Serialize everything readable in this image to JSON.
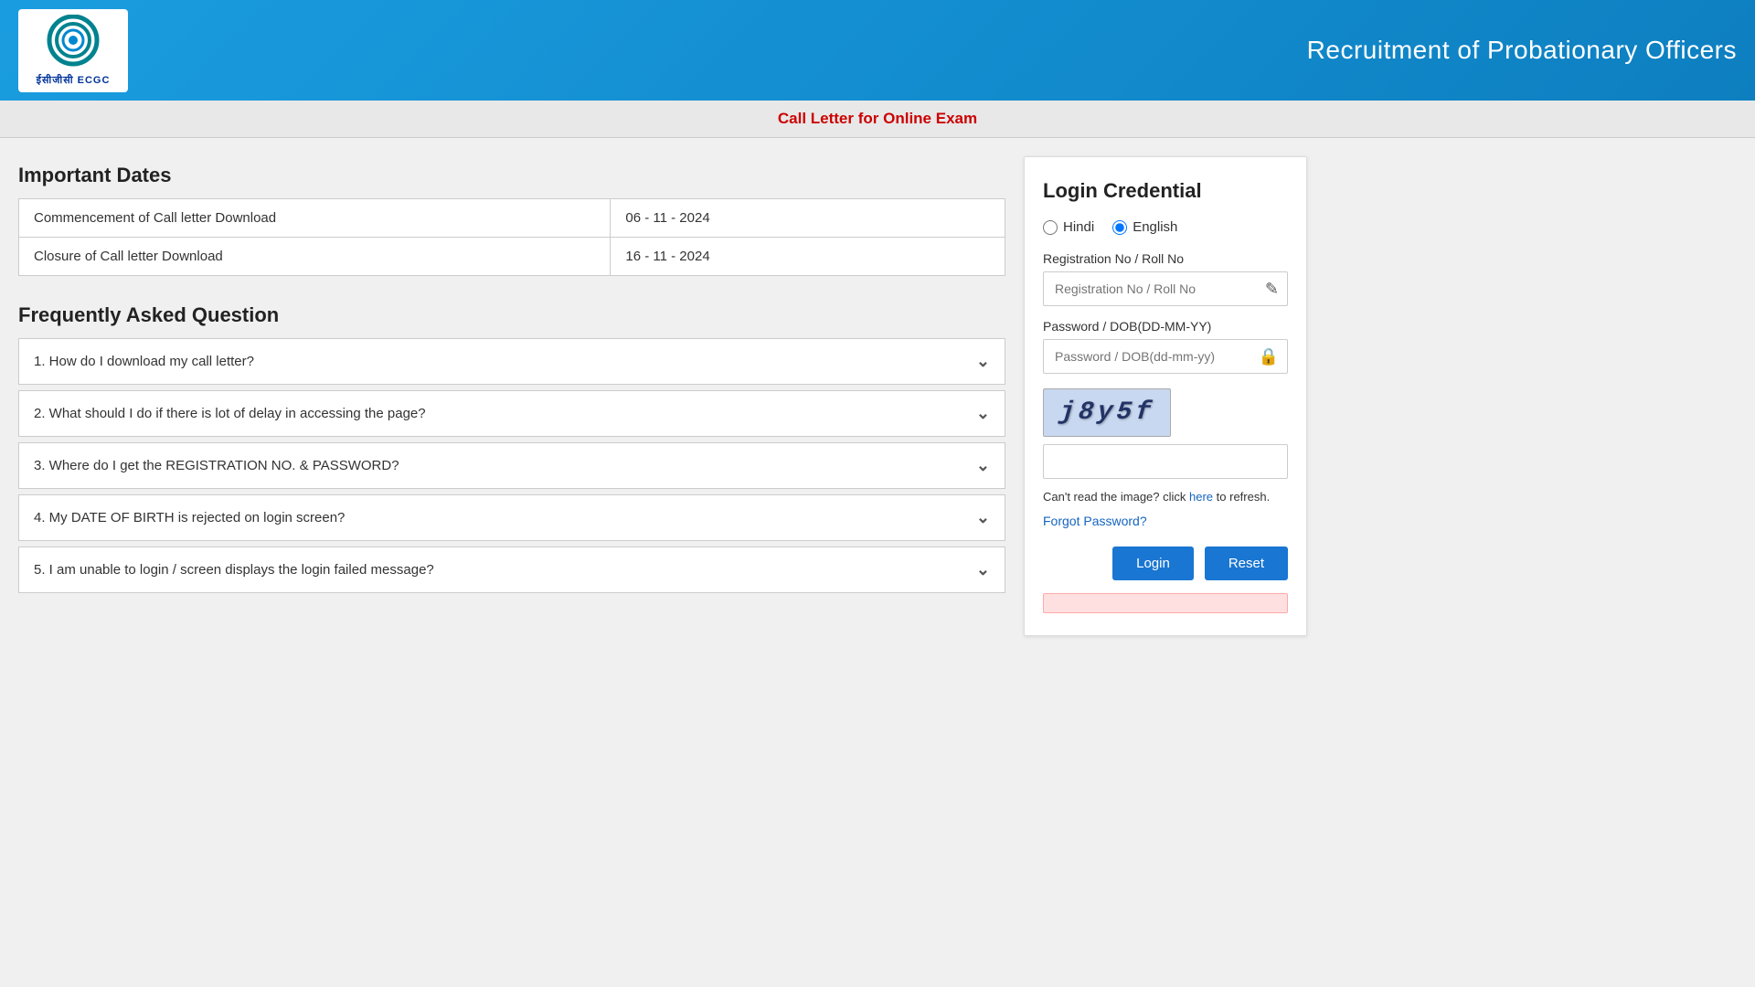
{
  "header": {
    "logo_text": "ईसीजीसी ECGC",
    "title": "Recruitment of Probationary Officers"
  },
  "sub_header": {
    "label": "Call Letter for Online Exam"
  },
  "important_dates": {
    "section_title": "Important Dates",
    "rows": [
      {
        "label": "Commencement of Call letter Download",
        "date": "06 - 11 - 2024"
      },
      {
        "label": "Closure of Call letter Download",
        "date": "16 - 11 - 2024"
      }
    ]
  },
  "faq": {
    "section_title": "Frequently Asked Question",
    "items": [
      {
        "id": 1,
        "question": "1. How do I download my call letter?"
      },
      {
        "id": 2,
        "question": "2. What should I do if there is lot of delay in accessing the page?"
      },
      {
        "id": 3,
        "question": "3. Where do I get the REGISTRATION NO. & PASSWORD?"
      },
      {
        "id": 4,
        "question": "4. My DATE OF BIRTH is rejected on login screen?"
      },
      {
        "id": 5,
        "question": "5. I am unable to login / screen displays the login failed message?"
      }
    ]
  },
  "login": {
    "title": "Login Credential",
    "language": {
      "hindi_label": "Hindi",
      "english_label": "English",
      "selected": "english"
    },
    "registration_field": {
      "label": "Registration No / Roll No",
      "placeholder": "Registration No / Roll No"
    },
    "password_field": {
      "label": "Password / DOB(DD-MM-YY)",
      "placeholder": "Password / DOB(dd-mm-yy)"
    },
    "captcha": {
      "value": "j8y5f",
      "input_placeholder": "",
      "refresh_text": "Can't read the image? click ",
      "refresh_link": "here",
      "refresh_suffix": " to refresh."
    },
    "forgot_password": "Forgot Password?",
    "buttons": {
      "login_label": "Login",
      "reset_label": "Reset"
    }
  }
}
